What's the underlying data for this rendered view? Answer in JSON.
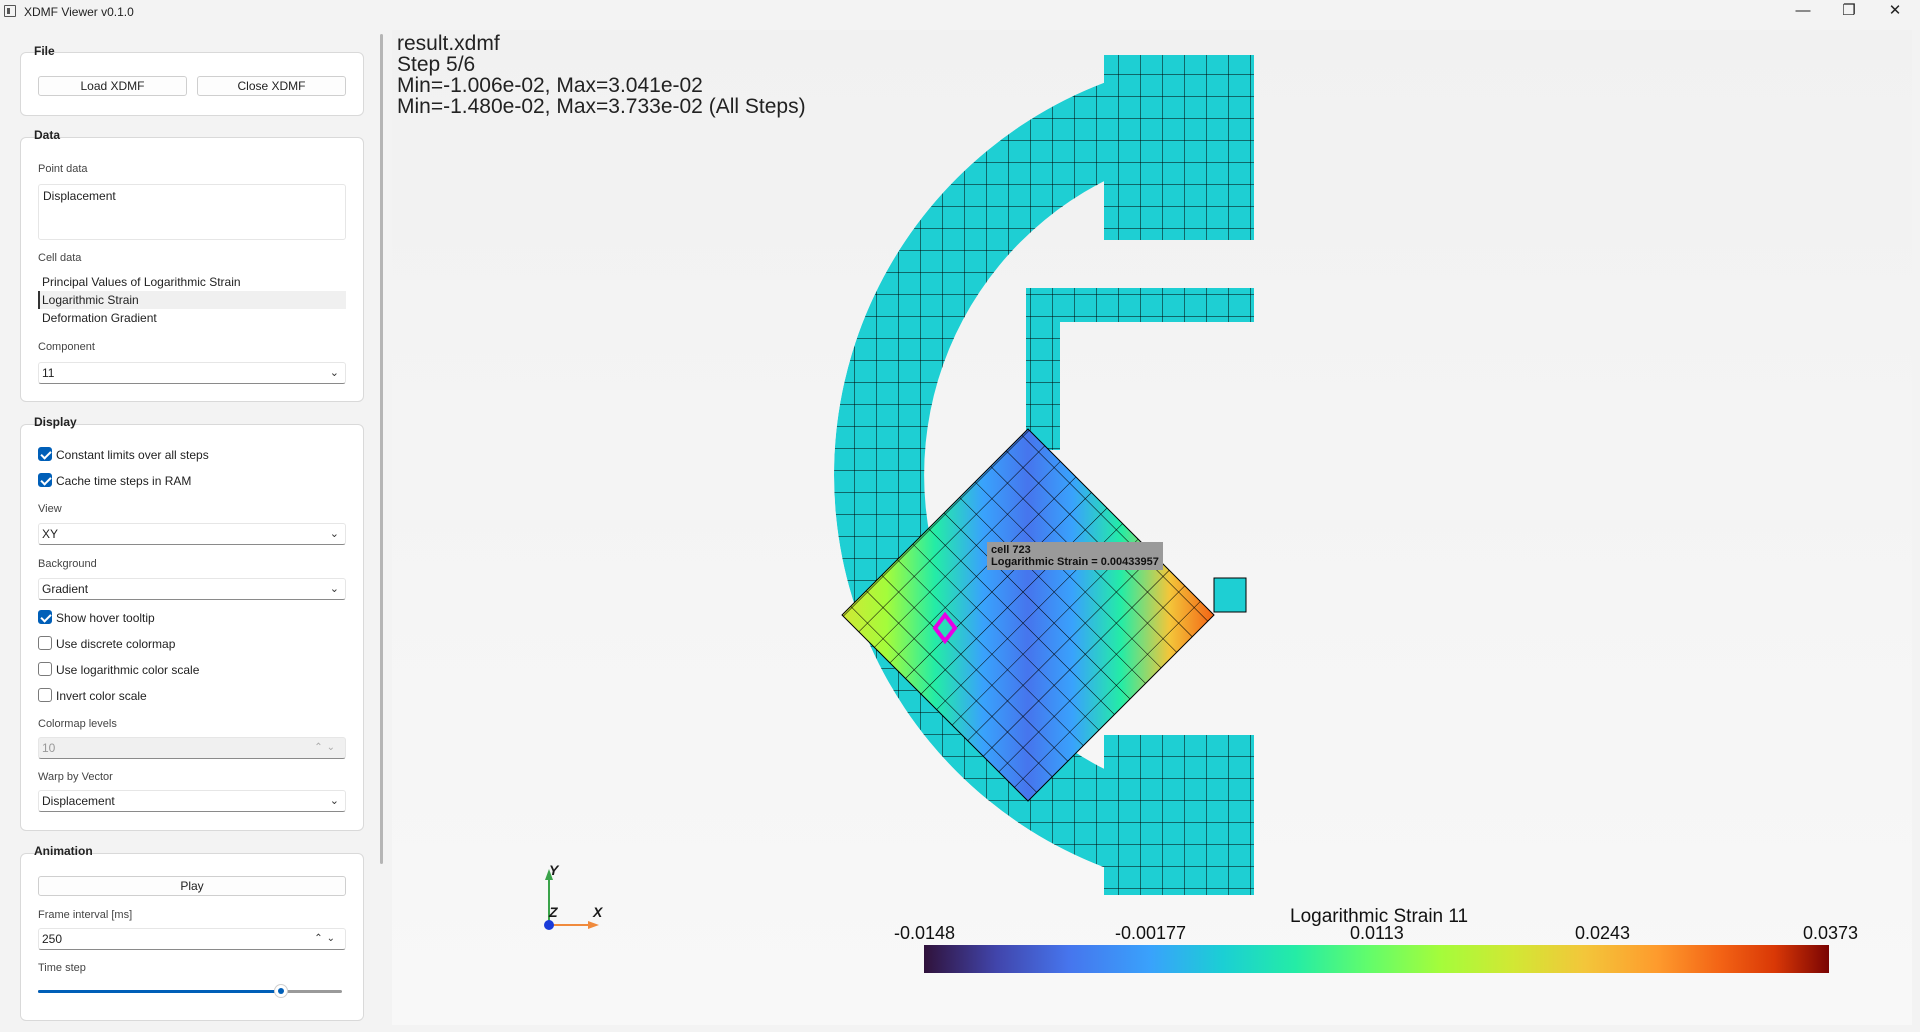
{
  "window": {
    "title": "XDMF Viewer v0.1.0",
    "minimize": "—",
    "maximize": "❐",
    "close": "✕"
  },
  "file": {
    "title": "File",
    "load_label": "Load XDMF",
    "close_label": "Close XDMF"
  },
  "data": {
    "title": "Data",
    "point_data_label": "Point data",
    "point_data_items": [
      "Displacement"
    ],
    "cell_data_label": "Cell data",
    "cell_data_items": [
      "Principal Values of Logarithmic Strain",
      "Logarithmic Strain",
      "Deformation Gradient"
    ],
    "cell_data_selected": "Logarithmic Strain",
    "component_label": "Component",
    "component_value": "11"
  },
  "display": {
    "title": "Display",
    "constant_limits_label": "Constant limits over all steps",
    "constant_limits": true,
    "cache_label": "Cache time steps in RAM",
    "cache": true,
    "view_label": "View",
    "view_value": "XY",
    "background_label": "Background",
    "background_value": "Gradient",
    "tooltip_label": "Show hover tooltip",
    "tooltip": true,
    "discrete_label": "Use discrete colormap",
    "discrete": false,
    "log_label": "Use logarithmic color scale",
    "log": false,
    "invert_label": "Invert color scale",
    "invert": false,
    "levels_label": "Colormap levels",
    "levels_value": "10",
    "warp_label": "Warp by Vector",
    "warp_value": "Displacement"
  },
  "animation": {
    "title": "Animation",
    "play_label": "Play",
    "interval_label": "Frame interval [ms]",
    "interval_value": "250",
    "time_step_label": "Time step",
    "time_step_fraction": 0.8
  },
  "viewport": {
    "file_name": "result.xdmf",
    "step": "Step 5/6",
    "range_step": "Min=-1.006e-02, Max=3.041e-02",
    "range_all": "Min=-1.480e-02, Max=3.733e-02 (All Steps)",
    "tooltip_line1": "cell 723",
    "tooltip_line2": "Logarithmic Strain = 0.00433957",
    "axes": {
      "x": "X",
      "y": "Y",
      "z": "Z"
    },
    "colorbar_title": "Logarithmic Strain 11",
    "colorbar_ticks": [
      "-0.0148",
      "-0.00177",
      "0.0113",
      "0.0243",
      "0.0373"
    ],
    "colors": {
      "mesh_base": "#1ecfd3",
      "selected_cell": "#e600e6",
      "accent": "#005fb8"
    }
  }
}
